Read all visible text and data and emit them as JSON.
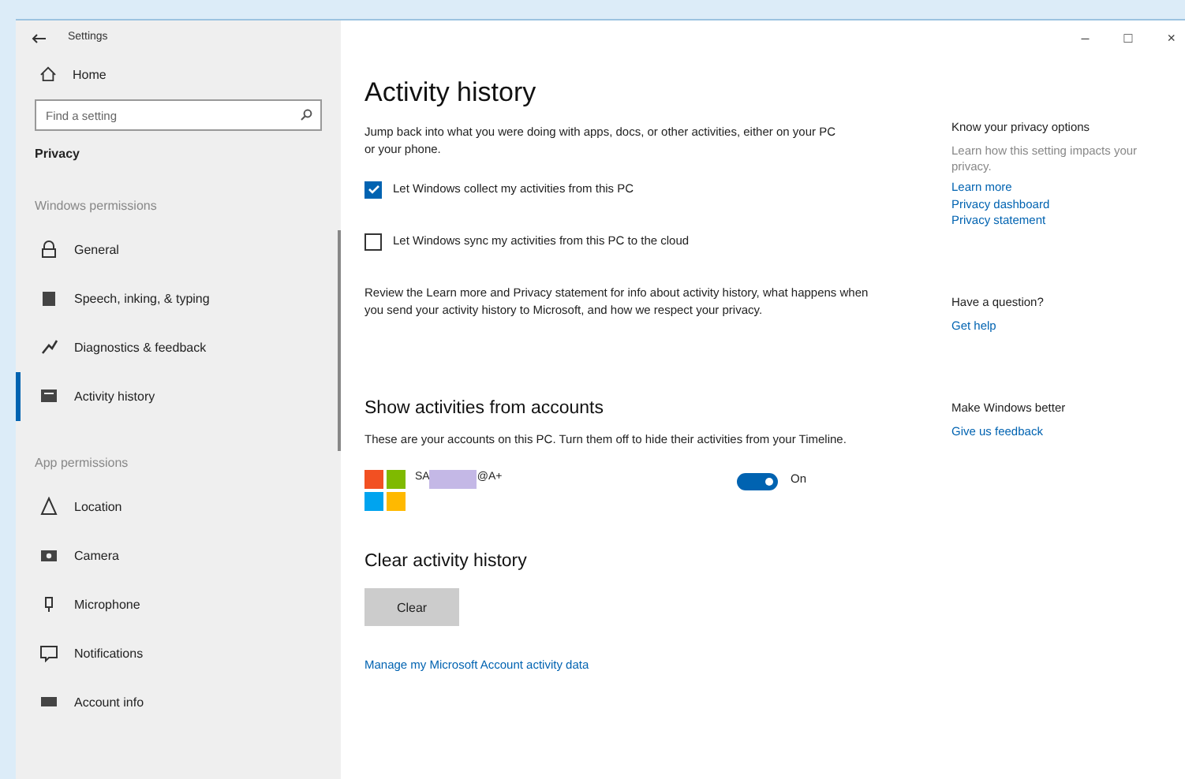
{
  "window": {
    "title": "Settings",
    "controls": [
      "–",
      "□",
      "×"
    ]
  },
  "sidebar": {
    "home": "Home",
    "search": {
      "placeholder": "Find a setting"
    },
    "section": "Privacy",
    "groups": [
      {
        "heading": "Windows permissions",
        "items": [
          {
            "label": "General",
            "selected": false
          },
          {
            "label": "Speech, inking, & typing",
            "selected": false
          },
          {
            "label": "Diagnostics & feedback",
            "selected": false
          },
          {
            "label": "Activity history",
            "selected": true
          }
        ]
      },
      {
        "heading": "App permissions",
        "items": [
          {
            "label": "Location",
            "selected": false
          },
          {
            "label": "Camera",
            "selected": false
          },
          {
            "label": "Microphone",
            "selected": false
          },
          {
            "label": "Notifications",
            "selected": false
          },
          {
            "label": "Account info",
            "selected": false
          }
        ]
      }
    ]
  },
  "main": {
    "title": "Activity history",
    "intro": "Jump back into what you were doing with apps, docs, or other activities, either on your PC or your phone.",
    "checkboxes": [
      {
        "label": "Let Windows collect my activities from this PC",
        "checked": true
      },
      {
        "label": "Let Windows sync my activities from this PC to the cloud",
        "checked": false
      }
    ],
    "review": "Review the Learn more and Privacy statement for info about activity history, what happens when you send your activity history to Microsoft, and how we respect your privacy.",
    "accounts_title": "Show activities from accounts",
    "accounts_text": "These are your accounts on this PC. Turn them off to hide their activities from your Timeline.",
    "account": {
      "name_start": "SA",
      "name_end": "@A+",
      "on": true,
      "state": "On"
    },
    "clear_title": "Clear activity history",
    "clear_button": "Clear",
    "manage_link": "Manage my Microsoft Account activity data"
  },
  "aside": {
    "sections": [
      {
        "title": "Know your privacy options",
        "text": "Learn how this setting impacts your privacy.",
        "links": [
          "Learn more",
          "Privacy dashboard",
          "Privacy statement"
        ]
      },
      {
        "title": "Have a question?",
        "links": [
          "Get help"
        ]
      },
      {
        "title": "Make Windows better",
        "links": [
          "Give us feedback"
        ]
      }
    ]
  }
}
